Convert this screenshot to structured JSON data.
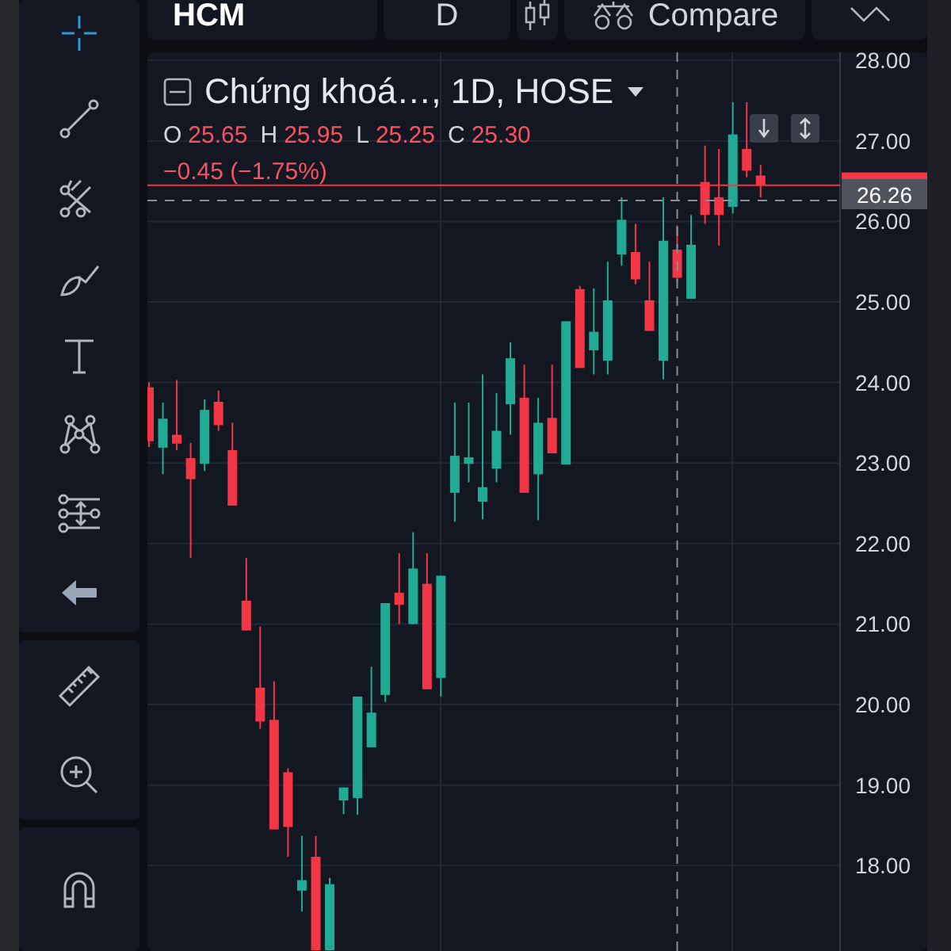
{
  "toolbar": {
    "symbol": "HCM",
    "interval": "D",
    "compare": "Compare"
  },
  "legend": {
    "title": "Chứng khoá…, 1D, HOSE",
    "ohlc": [
      {
        "label": "O",
        "value": "25.65"
      },
      {
        "label": "H",
        "value": "25.95"
      },
      {
        "label": "L",
        "value": "25.25"
      },
      {
        "label": "C",
        "value": "25.30"
      }
    ],
    "change": "−0.45 (−1.75%)"
  },
  "price_axis": {
    "crosshair_price": "26.26"
  },
  "chart_data": {
    "type": "candlestick",
    "grid": true,
    "ylim": [
      16.94,
      28.1
    ],
    "ref_lines": [
      {
        "axis": "y",
        "value": 26.45,
        "color": "#f23645"
      },
      {
        "axis": "y",
        "value": 26.26,
        "color": "#8a8e99"
      }
    ],
    "yticks": [
      {
        "value": 18,
        "label": "18.00"
      },
      {
        "value": 19,
        "label": "19.00"
      },
      {
        "value": 20,
        "label": "20.00"
      },
      {
        "value": 21,
        "label": "21.00"
      },
      {
        "value": 22,
        "label": "22.00"
      },
      {
        "value": 23,
        "label": "23.00"
      },
      {
        "value": 24,
        "label": "24.00"
      },
      {
        "value": 25,
        "label": "25.00"
      },
      {
        "value": 26,
        "label": "26.00"
      },
      {
        "value": 27,
        "label": "27.00"
      },
      {
        "value": 28,
        "label": "28.00"
      }
    ],
    "ohlc": [
      [
        23.94,
        24.0,
        23.2,
        23.27
      ],
      [
        23.19,
        23.75,
        22.86,
        23.55
      ],
      [
        23.35,
        24.03,
        23.16,
        23.24
      ],
      [
        23.06,
        23.25,
        21.82,
        22.8
      ],
      [
        22.99,
        23.79,
        22.9,
        23.66
      ],
      [
        23.76,
        23.9,
        23.4,
        23.47
      ],
      [
        23.16,
        23.5,
        22.47,
        22.47
      ],
      [
        21.29,
        21.82,
        20.92,
        20.92
      ],
      [
        20.21,
        20.97,
        19.7,
        19.79
      ],
      [
        19.81,
        20.29,
        18.45,
        18.45
      ],
      [
        19.16,
        19.21,
        18.11,
        18.48
      ],
      [
        17.69,
        18.37,
        17.43,
        17.82
      ],
      [
        18.11,
        18.37,
        16.95,
        16.95
      ],
      [
        16.95,
        17.85,
        16.95,
        17.77
      ],
      [
        18.81,
        18.97,
        18.64,
        18.97
      ],
      [
        18.84,
        20.1,
        18.63,
        20.1
      ],
      [
        19.47,
        20.47,
        19.47,
        19.9
      ],
      [
        20.12,
        21.26,
        20.03,
        21.26
      ],
      [
        21.39,
        21.88,
        21.0,
        21.24
      ],
      [
        21.0,
        22.14,
        21.0,
        21.69
      ],
      [
        21.5,
        21.88,
        20.19,
        20.19
      ],
      [
        20.33,
        21.6,
        20.1,
        21.6
      ],
      [
        22.63,
        23.75,
        22.27,
        23.09
      ],
      [
        22.99,
        23.75,
        22.76,
        23.07
      ],
      [
        22.52,
        24.1,
        22.3,
        22.7
      ],
      [
        22.93,
        23.87,
        22.76,
        23.4
      ],
      [
        23.73,
        24.5,
        23.35,
        24.3
      ],
      [
        23.81,
        24.22,
        22.63,
        22.63
      ],
      [
        22.86,
        23.81,
        22.29,
        23.5
      ],
      [
        23.56,
        24.22,
        23.12,
        23.12
      ],
      [
        22.98,
        24.76,
        22.98,
        24.76
      ],
      [
        25.16,
        25.2,
        24.18,
        24.18
      ],
      [
        24.4,
        25.17,
        24.1,
        24.63
      ],
      [
        24.27,
        25.5,
        24.1,
        25.02
      ],
      [
        25.59,
        26.3,
        25.45,
        26.02
      ],
      [
        25.62,
        25.97,
        25.22,
        25.28
      ],
      [
        25.02,
        25.5,
        24.64,
        24.64
      ],
      [
        24.27,
        26.3,
        24.04,
        25.76
      ],
      [
        25.65,
        25.95,
        25.25,
        25.3
      ],
      [
        25.04,
        26.08,
        25.04,
        25.71
      ],
      [
        26.49,
        26.94,
        25.97,
        26.08
      ],
      [
        26.3,
        26.9,
        25.7,
        26.08
      ],
      [
        26.18,
        27.48,
        26.1,
        27.08
      ],
      [
        26.9,
        27.48,
        26.55,
        26.63
      ],
      [
        26.57,
        26.7,
        26.3,
        26.45
      ]
    ]
  }
}
